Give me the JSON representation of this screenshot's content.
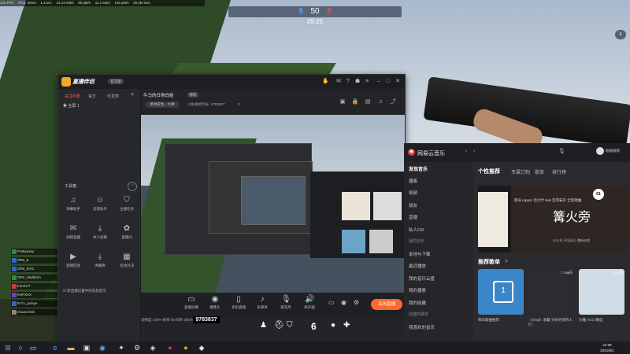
{
  "perf": {
    "fps": "126 FPS",
    "ping": "Ping: 48ms",
    "loss": "1.4.sec",
    "in": "14.24 KB/s",
    "in_pkts": "80 pkt/s",
    "out": "11.1 KB/s",
    "out_pkts": "115 pkt/s",
    "jitter": "25 pkt loss"
  },
  "scoreboard": {
    "ct": "5",
    "round": "50",
    "t": "2",
    "timer": "09:25"
  },
  "top_right_count": "6",
  "stream_app": {
    "logo": "直播伴侣",
    "version": "官方版",
    "tabs": [
      "关注列表",
      "官方",
      "可发表"
    ],
    "add_tab": "+",
    "list_item": "全屏 1",
    "room_title": "牛马的日常白给",
    "room_edit": "修改",
    "room_category": "绝地求生 - 大神",
    "room_meta": "小帐发给时光",
    "room_id": "9783837",
    "room_likes": "0",
    "toolbox_label": "工具箱",
    "toolbox_more": "⋯",
    "tools": [
      {
        "icon": "music-icon",
        "glyph": "♫",
        "label": "弹幕助手"
      },
      {
        "icon": "user-icon",
        "glyph": "☺",
        "label": "房管助手"
      },
      {
        "icon": "shield-icon",
        "glyph": "⛉",
        "label": "主播任务"
      },
      {
        "icon": "chat-icon",
        "glyph": "✉",
        "label": "视频直播"
      },
      {
        "icon": "download-icon",
        "glyph": "⤓",
        "label": "本人投稿"
      },
      {
        "icon": "gift-icon",
        "glyph": "✿",
        "label": "直播间"
      },
      {
        "icon": "play-icon",
        "glyph": "▶",
        "label": "直播回放"
      },
      {
        "icon": "download-icon",
        "glyph": "⤓",
        "label": "弹幕库"
      },
      {
        "icon": "grid-icon",
        "glyph": "▦",
        "label": "投放对决"
      }
    ],
    "notify": "☑ 新直播设置中的消息提示",
    "bottom_tools": [
      {
        "icon": "screen-icon",
        "glyph": "▭",
        "label": "直播屏幕"
      },
      {
        "icon": "camera-icon",
        "glyph": "◉",
        "label": "摄像头"
      },
      {
        "icon": "phone-icon",
        "glyph": "▯",
        "label": "多机直播"
      },
      {
        "icon": "mic-icon",
        "glyph": "♪",
        "label": "多媒体"
      },
      {
        "icon": "mic-icon",
        "glyph": "🎙",
        "label": "麦克风"
      },
      {
        "icon": "speaker-icon",
        "glyph": "🔊",
        "label": "扬声器"
      }
    ],
    "live_button": "关闭直播",
    "status": "流畅度 100%   帧率 59   码率 4567kbps   CPU 34%"
  },
  "netease": {
    "logo": "网易云音乐",
    "user": "粘碰碰嗯",
    "sidebar": [
      {
        "label": "发现音乐",
        "kind": "h"
      },
      {
        "label": "播客",
        "kind": ""
      },
      {
        "label": "视频",
        "kind": ""
      },
      {
        "label": "朋友",
        "kind": ""
      },
      {
        "label": "直播",
        "kind": ""
      },
      {
        "label": "私人FM",
        "kind": ""
      },
      {
        "label": "我的音乐",
        "kind": "sub"
      },
      {
        "label": "本地与下载",
        "kind": ""
      },
      {
        "label": "最近播放",
        "kind": ""
      },
      {
        "label": "我的音乐云盘",
        "kind": ""
      },
      {
        "label": "我的播客",
        "kind": ""
      },
      {
        "label": "我的收藏",
        "kind": ""
      },
      {
        "label": "创建的歌单",
        "kind": "sub"
      },
      {
        "label": "我喜欢的音乐",
        "kind": ""
      }
    ],
    "tabs": [
      "个性推荐",
      "专属订制",
      "歌单",
      "排行榜"
    ],
    "banner_caption": "新号 rapper 吕大叶 feat 宫风安声 全新歌曲",
    "banner_title": "篝火旁",
    "banner_sub": "2021年 不忘初心 重新启程",
    "banner_badge": "61",
    "section_title": "推荐歌单",
    "section_arrow": ">",
    "cards": [
      {
        "caption": "每日歌曲推荐",
        "count": "",
        "glyph": "1"
      },
      {
        "caption": "《Vinyl》收藏 分好的你的人们",
        "count": "▷788万",
        "glyph": ""
      },
      {
        "caption": "沙雕 ACG 精选",
        "count": "▷219万",
        "glyph": ""
      }
    ],
    "user_id": "9783837"
  },
  "kill_feed": [
    {
      "name": "Prettyasey",
      "color": "#2d8a3e"
    },
    {
      "name": "ORe_6",
      "color": "#2d6ac8"
    },
    {
      "name": "ORe_BYG",
      "color": "#2d6ac8"
    },
    {
      "name": "ORe_Stubbom",
      "color": "#2d8a3e"
    },
    {
      "name": "Ironrivr7",
      "color": "#c83a3a"
    },
    {
      "name": "KHFXXX",
      "color": "#7a3ac8"
    },
    {
      "name": "5cTv_pulaye",
      "color": "#2d6ac8"
    },
    {
      "name": "chuanchnb",
      "color": "#888888"
    }
  ],
  "hud": {
    "ammo": "6"
  },
  "taskbar": {
    "clock_time": "22:38",
    "clock_date": "2021/6/1"
  }
}
